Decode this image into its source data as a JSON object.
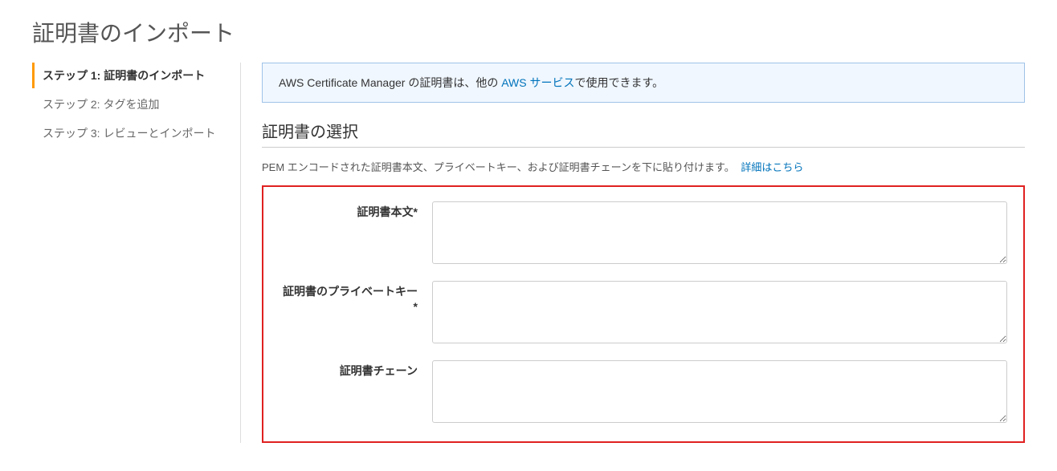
{
  "page": {
    "title": "証明書のインポート"
  },
  "sidebar": {
    "steps": [
      {
        "label": "ステップ 1: 証明書のインポート"
      },
      {
        "label": "ステップ 2: タグを追加"
      },
      {
        "label": "ステップ 3: レビューとインポート"
      }
    ]
  },
  "info": {
    "pre": "AWS Certificate Manager の証明書は、他の ",
    "link": "AWS サービス",
    "post": "で使用できます。"
  },
  "selection": {
    "title": "証明書の選択",
    "desc": "PEM エンコードされた証明書本文、プライベートキー、および証明書チェーンを下に貼り付けます。",
    "learn_more": "詳細はこちら"
  },
  "form": {
    "body": {
      "label": "証明書本文*",
      "value": ""
    },
    "private_key": {
      "label": "証明書のプライベートキー*",
      "value": ""
    },
    "chain": {
      "label": "証明書チェーン",
      "value": ""
    }
  }
}
